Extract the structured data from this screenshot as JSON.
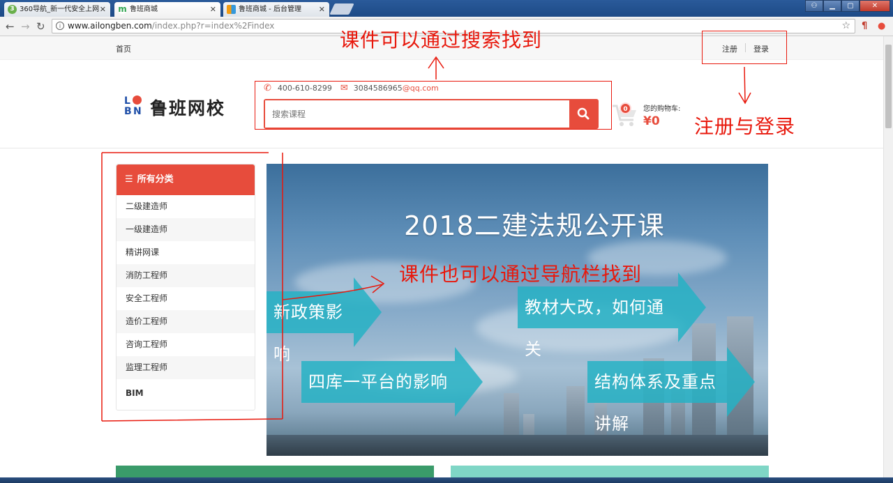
{
  "browser": {
    "tabs": [
      {
        "label": "360导航_新一代安全上网",
        "icon": "360-icon"
      },
      {
        "label": "鲁班商城",
        "icon": "m-icon"
      },
      {
        "label": "鲁班商城 - 后台管理",
        "icon": "grid-icon"
      }
    ],
    "url_host": "www.ailongben.com",
    "url_path": "/index.php?r=index%2Findex"
  },
  "topnav": {
    "home": "首页",
    "register": "注册",
    "login": "登录"
  },
  "header": {
    "logo_letters": [
      "L",
      "B",
      "N"
    ],
    "logo_text": "鲁班网校",
    "phone": "400-610-8299",
    "email_prefix": "3084586965",
    "email_domain": "@qq.com",
    "search_placeholder": "搜索课程",
    "cart_label": "您的购物车:",
    "cart_count": "0",
    "cart_amount": "¥0"
  },
  "sidebar": {
    "title": "所有分类",
    "items": [
      "二级建造师",
      "一级建造师",
      "精讲网课",
      "消防工程师",
      "安全工程师",
      "造价工程师",
      "咨询工程师",
      "监理工程师",
      "BIM"
    ]
  },
  "banner": {
    "title": "2018二建法规公开课",
    "arrows": [
      "新政策影响",
      "教材大改，如何通关",
      "四库一平台的影响",
      "结构体系及重点讲解"
    ]
  },
  "annotations": {
    "search": "课件可以通过搜索找到",
    "nav": "课件也可以通过导航栏找到",
    "login": "注册与登录"
  },
  "colors": {
    "accent": "#e74c3c",
    "annotation": "#e8180c",
    "banner_arrow": "#26b2c4"
  }
}
